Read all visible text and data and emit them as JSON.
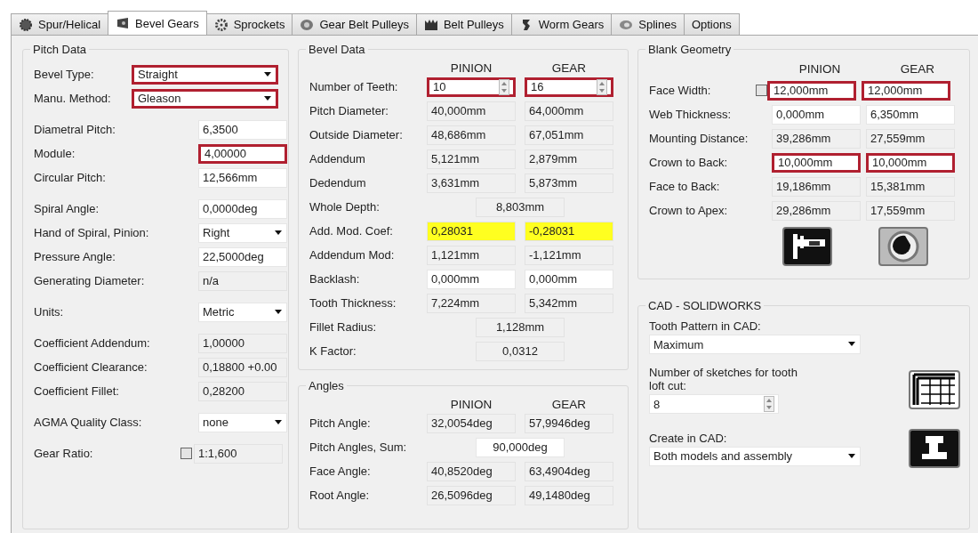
{
  "tabs": [
    {
      "label": "Spur/Helical",
      "kind": "gear",
      "selected": false
    },
    {
      "label": "Bevel Gears",
      "kind": "bevel",
      "selected": true
    },
    {
      "label": "Sprockets",
      "kind": "sprocket",
      "selected": false
    },
    {
      "label": "Gear Belt Pulleys",
      "kind": "pulley",
      "selected": false
    },
    {
      "label": "Belt Pulleys",
      "kind": "belt",
      "selected": false
    },
    {
      "label": "Worm Gears",
      "kind": "worm",
      "selected": false
    },
    {
      "label": "Splines",
      "kind": "spline",
      "selected": false
    },
    {
      "label": "Options",
      "kind": "plain",
      "selected": false
    }
  ],
  "pitch_data": {
    "title": "Pitch Data",
    "sections": [
      [
        {
          "label": "Bevel Type:",
          "field": {
            "kind": "select",
            "value": "Straight",
            "highlighted": true
          }
        },
        {
          "label": "Manu. Method:",
          "field": {
            "kind": "select",
            "value": "Gleason",
            "highlighted": true
          }
        }
      ],
      [
        {
          "label": "Diametral Pitch:",
          "field": {
            "kind": "input",
            "value": "6,3500",
            "highlighted": false
          }
        },
        {
          "label": "Module:",
          "field": {
            "kind": "input",
            "value": "4,00000",
            "highlighted": true
          }
        },
        {
          "label": "Circular Pitch:",
          "field": {
            "kind": "input",
            "value": "12,566mm",
            "highlighted": false
          }
        }
      ],
      [
        {
          "label": "Spiral Angle:",
          "field": {
            "kind": "input",
            "value": "0,0000deg",
            "highlighted": false
          }
        },
        {
          "label": "Hand of Spiral, Pinion:",
          "field": {
            "kind": "select",
            "value": "Right",
            "highlighted": false
          }
        },
        {
          "label": "Pressure Angle:",
          "field": {
            "kind": "input",
            "value": "22,5000deg",
            "highlighted": false
          }
        },
        {
          "label": "Generating Diameter:",
          "field": {
            "kind": "readonly",
            "value": "n/a",
            "highlighted": false
          }
        }
      ],
      [
        {
          "label": "Units:",
          "field": {
            "kind": "select",
            "value": "Metric",
            "highlighted": false
          }
        }
      ],
      [
        {
          "label": "Coefficient Addendum:",
          "field": {
            "kind": "readonly",
            "value": "1,00000",
            "highlighted": false
          }
        },
        {
          "label": "Coefficient Clearance:",
          "field": {
            "kind": "readonly",
            "value": "0,18800 +0.00",
            "highlighted": false
          }
        },
        {
          "label": "Coefficient Fillet:",
          "field": {
            "kind": "readonly",
            "value": "0,28200",
            "highlighted": false
          }
        }
      ],
      [
        {
          "label": "AGMA Quality Class:",
          "field": {
            "kind": "select",
            "value": "none",
            "highlighted": false
          }
        }
      ],
      [
        {
          "label": "Gear Ratio:",
          "checked": false,
          "field": {
            "kind": "readonly",
            "value": "1:1,600",
            "highlighted": false
          }
        }
      ]
    ]
  },
  "bevel_data": {
    "title": "Bevel Data",
    "headers": [
      "PINION",
      "GEAR"
    ],
    "rows": [
      {
        "label": "Number of Teeth:",
        "pinion": {
          "kind": "spin",
          "value": "10",
          "highlighted": true
        },
        "gear": {
          "kind": "spin",
          "value": "16",
          "highlighted": true
        }
      },
      {
        "label": "Pitch Diameter:",
        "pinion": {
          "kind": "readonly",
          "value": "40,000mm"
        },
        "gear": {
          "kind": "readonly",
          "value": "64,000mm"
        }
      },
      {
        "label": "Outside Diameter:",
        "pinion": {
          "kind": "readonly",
          "value": "48,686mm"
        },
        "gear": {
          "kind": "readonly",
          "value": "67,051mm"
        }
      },
      {
        "label": "Addendum",
        "pinion": {
          "kind": "readonly",
          "value": "5,121mm"
        },
        "gear": {
          "kind": "readonly",
          "value": "2,879mm"
        }
      },
      {
        "label": "Dedendum",
        "pinion": {
          "kind": "readonly",
          "value": "3,631mm"
        },
        "gear": {
          "kind": "readonly",
          "value": "5,873mm"
        }
      },
      {
        "label": "Whole Depth:",
        "combined": {
          "kind": "readonly",
          "value": "8,803mm"
        }
      },
      {
        "label": "Add. Mod. Coef:",
        "pinion": {
          "kind": "readonly",
          "value": "0,28031",
          "warning": true
        },
        "gear": {
          "kind": "readonly",
          "value": "-0,28031",
          "warning": true
        }
      },
      {
        "label": "Addendum Mod:",
        "pinion": {
          "kind": "readonly",
          "value": "1,121mm"
        },
        "gear": {
          "kind": "readonly",
          "value": "-1,121mm"
        }
      },
      {
        "label": "Backlash:",
        "pinion": {
          "kind": "input",
          "value": "0,000mm"
        },
        "gear": {
          "kind": "input",
          "value": "0,000mm"
        }
      },
      {
        "label": "Tooth Thickness:",
        "pinion": {
          "kind": "readonly",
          "value": "7,224mm"
        },
        "gear": {
          "kind": "readonly",
          "value": "5,342mm"
        }
      },
      {
        "label": "Fillet Radius:",
        "combined": {
          "kind": "readonly",
          "value": "1,128mm"
        }
      },
      {
        "label": "K Factor:",
        "combined": {
          "kind": "readonly",
          "value": "0,0312"
        }
      }
    ]
  },
  "angles": {
    "title": "Angles",
    "headers": [
      "PINION",
      "GEAR"
    ],
    "rows": [
      {
        "label": "Pitch Angle:",
        "pinion": {
          "kind": "readonly",
          "value": "32,0054deg"
        },
        "gear": {
          "kind": "readonly",
          "value": "57,9946deg"
        }
      },
      {
        "label": "Pitch Angles, Sum:",
        "combined": {
          "kind": "input",
          "value": "90,000deg"
        }
      },
      {
        "label": "Face Angle:",
        "pinion": {
          "kind": "readonly",
          "value": "40,8520deg"
        },
        "gear": {
          "kind": "readonly",
          "value": "63,4904deg"
        }
      },
      {
        "label": "Root Angle:",
        "pinion": {
          "kind": "readonly",
          "value": "26,5096deg"
        },
        "gear": {
          "kind": "readonly",
          "value": "49,1480deg"
        }
      }
    ]
  },
  "blank_geometry": {
    "title": "Blank Geometry",
    "headers": [
      "PINION",
      "GEAR"
    ],
    "rows": [
      {
        "label": "Face Width:",
        "checked": false,
        "pinion": {
          "kind": "input",
          "value": "12,000mm",
          "highlighted": true
        },
        "gear": {
          "kind": "input",
          "value": "12,000mm",
          "highlighted": true
        }
      },
      {
        "label": "Web Thickness:",
        "pinion": {
          "kind": "input",
          "value": "0,000mm"
        },
        "gear": {
          "kind": "input",
          "value": "6,350mm"
        }
      },
      {
        "label": "Mounting Distance:",
        "pinion": {
          "kind": "readonly",
          "value": "39,286mm"
        },
        "gear": {
          "kind": "readonly",
          "value": "27,559mm"
        }
      },
      {
        "label": "Crown to Back:",
        "pinion": {
          "kind": "input",
          "value": "10,000mm",
          "highlighted": true
        },
        "gear": {
          "kind": "input",
          "value": "10,000mm",
          "highlighted": true
        }
      },
      {
        "label": "Face to Back:",
        "pinion": {
          "kind": "readonly",
          "value": "19,186mm"
        },
        "gear": {
          "kind": "readonly",
          "value": "15,381mm"
        }
      },
      {
        "label": "Crown to Apex:",
        "pinion": {
          "kind": "readonly",
          "value": "29,286mm"
        },
        "gear": {
          "kind": "readonly",
          "value": "17,559mm"
        }
      }
    ]
  },
  "cad": {
    "title": "CAD - SOLIDWORKS",
    "tooth_pattern": {
      "label": "Tooth Pattern in CAD:",
      "value": "Maximum"
    },
    "sketches": {
      "label": "Number of sketches for tooth loft cut:",
      "value": "8"
    },
    "create": {
      "label": "Create in CAD:",
      "value": "Both models and assembly"
    }
  }
}
